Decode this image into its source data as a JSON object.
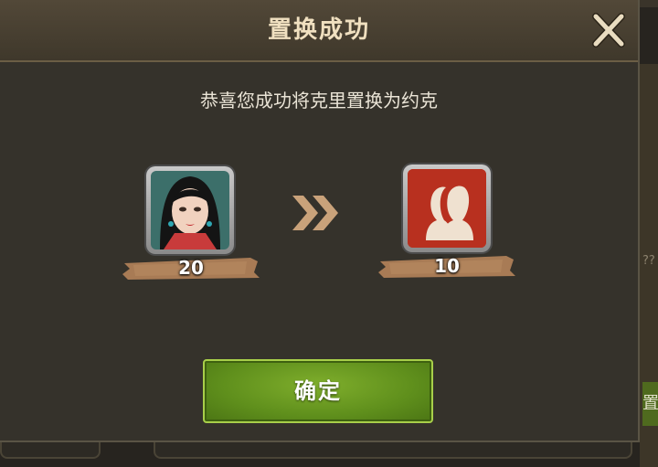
{
  "dialog": {
    "title": "置换成功",
    "message": "恭喜您成功将克里置换为约克",
    "close_icon": "close-icon",
    "confirm_label": "确定"
  },
  "source": {
    "icon": "hero-portrait",
    "count": "20"
  },
  "arrow_icon": "double-chevron-right-icon",
  "target": {
    "icon": "hero-silhouette-icon",
    "count": "10"
  },
  "background": {
    "right_hint": "??",
    "right_button_text": "置"
  },
  "colors": {
    "title_text": "#f0e0c0",
    "confirm_button": "#6a9a22",
    "arrow": "#c9a27a",
    "count_banner": "#a87b55",
    "target_tile": "#b8301f"
  }
}
